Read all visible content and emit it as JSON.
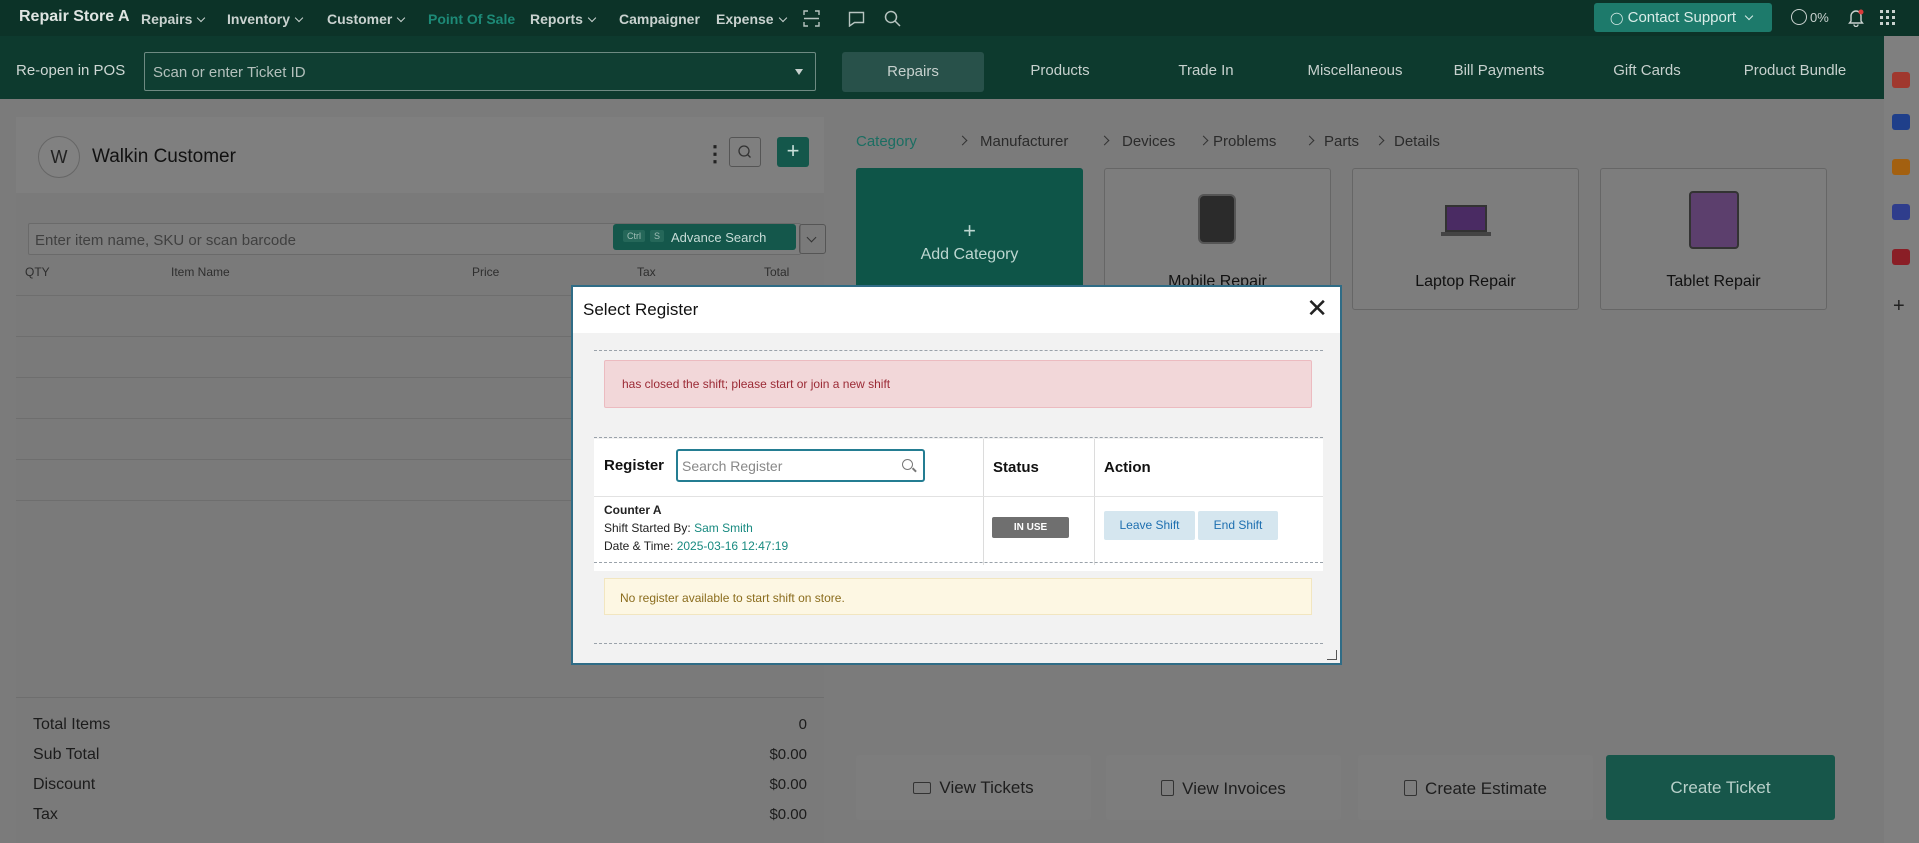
{
  "topnav": {
    "brand": "Repair Store A",
    "items": [
      {
        "label": "Repairs"
      },
      {
        "label": "Inventory"
      },
      {
        "label": "Customer"
      },
      {
        "label": "Point Of Sale"
      },
      {
        "label": "Reports"
      },
      {
        "label": "Campaigner"
      },
      {
        "label": "Expense"
      }
    ],
    "support": "Contact Support",
    "progress": "0%",
    "active_color": "#1d8a77"
  },
  "pos_bar": {
    "reopen_label": "Re-open in POS",
    "ticket_placeholder": "Scan or enter Ticket ID",
    "tabs": [
      "Repairs",
      "Products",
      "Trade In",
      "Miscellaneous",
      "Bill Payments",
      "Gift Cards",
      "Product Bundle"
    ]
  },
  "customer": {
    "initial": "W",
    "name": "Walkin Customer"
  },
  "items": {
    "search_placeholder": "Enter item name, SKU or scan barcode",
    "kbd_ctrl": "Ctrl",
    "kbd_s": "S",
    "advance_search": "Advance Search",
    "columns": [
      "QTY",
      "Item Name",
      "Price",
      "Tax",
      "Total"
    ]
  },
  "summary": [
    {
      "label": "Total Items",
      "value": "0"
    },
    {
      "label": "Sub Total",
      "value": "$0.00"
    },
    {
      "label": "Discount",
      "value": "$0.00"
    },
    {
      "label": "Tax",
      "value": "$0.00"
    }
  ],
  "breadcrumb": [
    "Category",
    "Manufacturer",
    "Devices",
    "Problems",
    "Parts",
    "Details"
  ],
  "categories": {
    "add": "Add Category",
    "cards": [
      "Mobile Repair",
      "Laptop Repair",
      "Tablet Repair"
    ]
  },
  "bottom_actions": [
    "View Tickets",
    "View Invoices",
    "Create Estimate",
    "Create Ticket"
  ],
  "modal": {
    "title": "Select Register",
    "alert": "has closed the shift; please start or join a new shift",
    "col_register": "Register",
    "search_placeholder": "Search Register",
    "col_status": "Status",
    "col_action": "Action",
    "register": {
      "name": "Counter A",
      "started_by_label": "Shift Started By:",
      "started_by": "Sam Smith",
      "datetime_label": "Date & Time:",
      "datetime": "2025-03-16 12:47:19",
      "status": "IN USE",
      "leave": "Leave Shift",
      "end": "End Shift"
    },
    "notice": "No register available to start shift on store."
  }
}
